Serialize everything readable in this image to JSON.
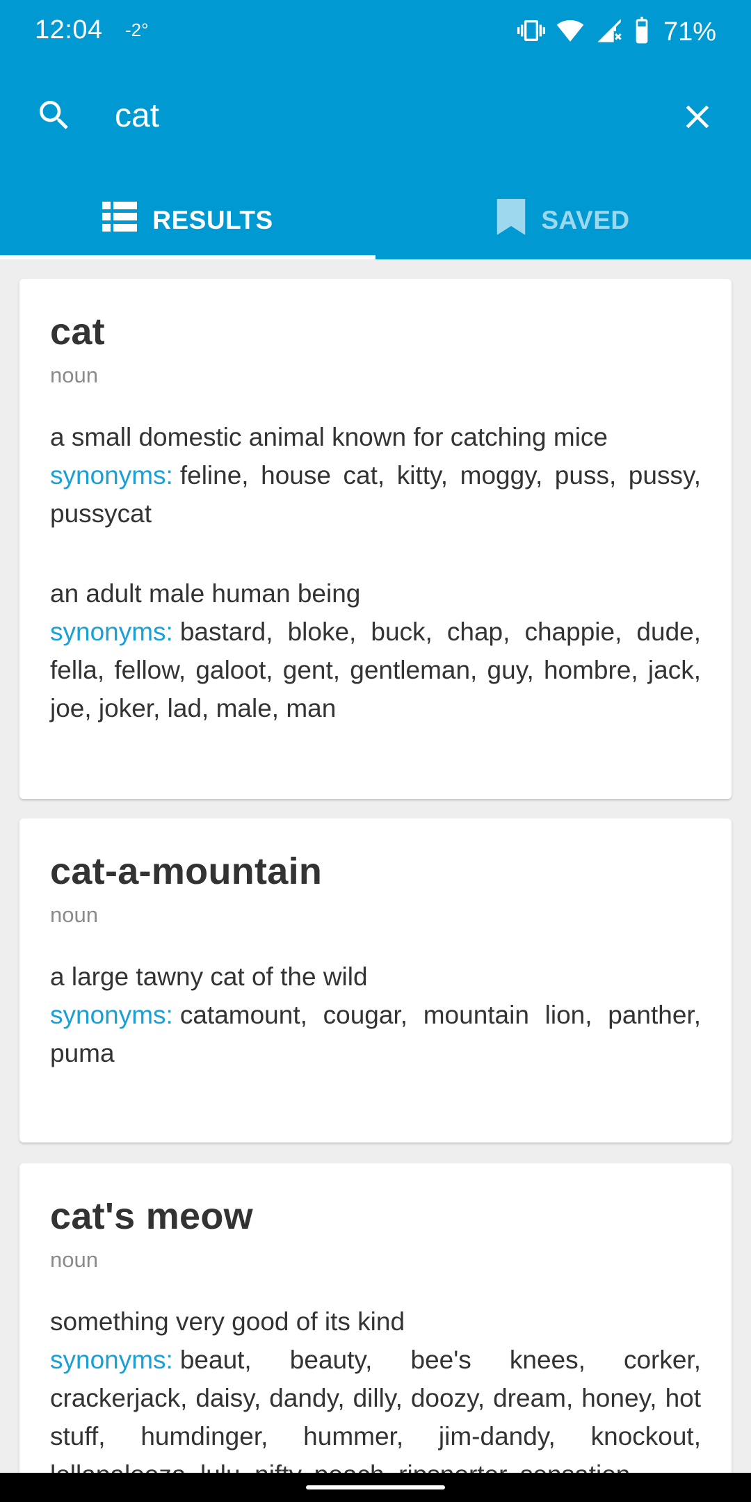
{
  "status_bar": {
    "time": "12:04",
    "temperature": "-2°",
    "battery_percent": "71%",
    "icons": [
      "vibrate-icon",
      "wifi-icon",
      "cell-signal-icon",
      "battery-icon"
    ]
  },
  "search": {
    "query": "cat",
    "placeholder": ""
  },
  "tabs": [
    {
      "label": "RESULTS",
      "icon": "list-icon",
      "selected": true
    },
    {
      "label": "SAVED",
      "icon": "bookmark-icon",
      "selected": false
    }
  ],
  "results": [
    {
      "word": "cat",
      "pos": "noun",
      "senses": [
        {
          "gloss": "a small domestic animal known for catching mice",
          "synonyms_label": "synonyms:",
          "synonyms": "feline, house cat, kitty, moggy, puss, pussy, pussycat"
        },
        {
          "gloss": "an adult male human being",
          "synonyms_label": "synonyms:",
          "synonyms": "bastard, bloke, buck, chap, chappie, dude, fella, fellow, galoot, gent, gentleman, guy, hombre, jack, joe, joker, lad, male, man"
        }
      ]
    },
    {
      "word": "cat-a-mountain",
      "pos": "noun",
      "senses": [
        {
          "gloss": "a large tawny cat of the wild",
          "synonyms_label": "synonyms:",
          "synonyms": "catamount, cougar, mountain lion, panther, puma"
        }
      ]
    },
    {
      "word": "cat's meow",
      "pos": "noun",
      "senses": [
        {
          "gloss": "something very good of its kind",
          "synonyms_label": "synonyms:",
          "synonyms": "beaut, beauty, bee's knees, corker, crackerjack, daisy, dandy, dilly, doozy, dream, honey, hot stuff, humdinger, hummer, jim-dandy, knockout, lollapalooza, lulu, nifty, peach, ripsnorter, sensation"
        }
      ]
    }
  ],
  "colors": {
    "primary": "#0199d1",
    "accent_text": "#1a9fd6",
    "background": "#eeeeee",
    "card": "#ffffff"
  }
}
